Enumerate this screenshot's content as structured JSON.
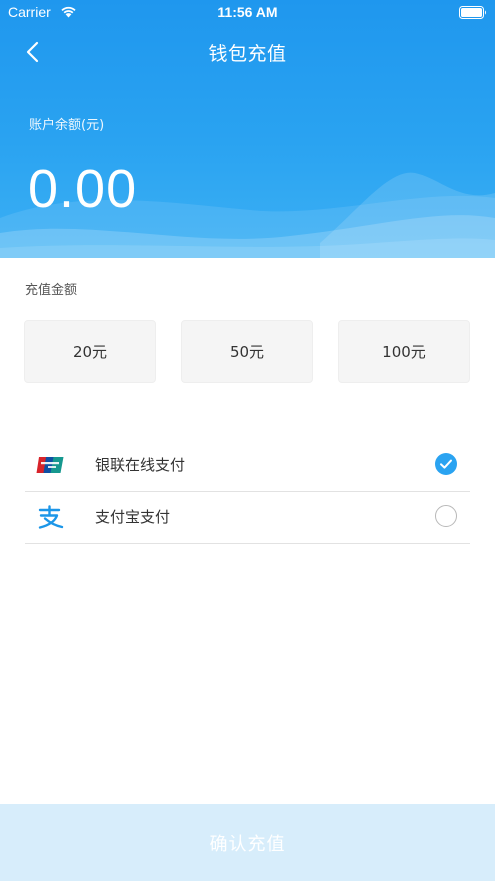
{
  "status_bar": {
    "carrier": "Carrier",
    "time": "11:56 AM"
  },
  "nav": {
    "title": "钱包充值",
    "back_icon": "chevron-left-icon"
  },
  "balance": {
    "label": "账户余额(元)",
    "value": "0.00"
  },
  "recharge": {
    "label": "充值金额",
    "options": [
      "20元",
      "50元",
      "100元"
    ]
  },
  "payment_methods": [
    {
      "label": "银联在线支付",
      "icon": "unionpay-icon",
      "selected": true
    },
    {
      "label": "支付宝支付",
      "icon": "alipay-icon",
      "selected": false
    }
  ],
  "confirm_label": "确认充值",
  "colors": {
    "primary": "#2aa3f1",
    "header_top": "#1f97ee",
    "confirm_disabled_bg": "#d7edfb"
  }
}
